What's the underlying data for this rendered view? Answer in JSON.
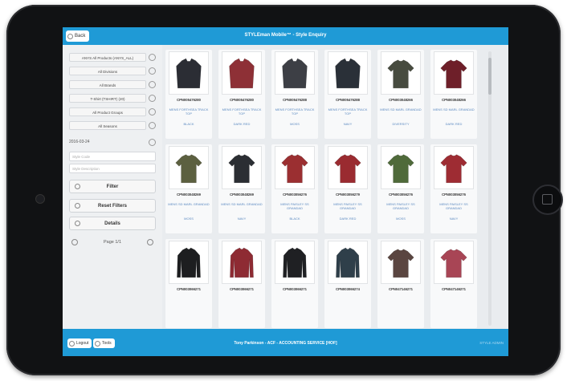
{
  "header": {
    "back_label": "Back",
    "title": "STYLEman Mobile™ - Style Enquiry"
  },
  "filters": {
    "product_scope": "ANYS All Products (ANYS_ALL)",
    "division": "All Divisions",
    "brand": "All Brands",
    "product_type": "T-Shirt (TSHIRT) (20)",
    "product_group": "All Product Groups",
    "season": "All Seasons",
    "date": "2016-03-24",
    "style_code_placeholder": "Style Code",
    "description_placeholder": "Style Description",
    "filter_label": "Filter",
    "reset_label": "Reset Filters",
    "details_label": "Details",
    "page_label": "Page 1/1"
  },
  "products": [
    {
      "code": "CPN005476280",
      "desc": "MENS FORTHSEA TRACK TOP",
      "color": "BLACK",
      "hex": "#2b2d34",
      "shape": "jacket"
    },
    {
      "code": "CPN005476280",
      "desc": "MENS FORTHSEA TRACK TOP",
      "color": "DARK RED",
      "hex": "#8e3036",
      "shape": "jacket"
    },
    {
      "code": "CPN005476288",
      "desc": "MENS FORTHSEA TRACK TOP",
      "color": "MOSS",
      "hex": "#3d3f45",
      "shape": "jacket"
    },
    {
      "code": "CPN005476288",
      "desc": "MENS FORTHSEA TRACK TOP",
      "color": "NAVY",
      "hex": "#2a3038",
      "shape": "jacket"
    },
    {
      "code": "CPN003048266",
      "desc": "MENS SD MARL GRANDAD",
      "color": "DIVERSITY",
      "hex": "#474b3f",
      "shape": "tee"
    },
    {
      "code": "CPN003048266",
      "desc": "MENS SD MARL GRANDAD",
      "color": "DARK RED",
      "hex": "#6e1f29",
      "shape": "tee"
    },
    {
      "code": "CPN003048269",
      "desc": "MENS SD MARL GRANDAD",
      "color": "MOSS",
      "hex": "#5c6040",
      "shape": "tee"
    },
    {
      "code": "CPN003048269",
      "desc": "MENS SD MARL GRANDAD",
      "color": "NAVY",
      "hex": "#2b2e33",
      "shape": "tee"
    },
    {
      "code": "CPN003056276",
      "desc": "MENS PAISLEY SS GRANDAD",
      "color": "BLACK",
      "hex": "#9b2f31",
      "shape": "tee"
    },
    {
      "code": "CPN003056279",
      "desc": "MENS PAISLEY SS GRANDAD",
      "color": "DARK RED",
      "hex": "#9a2b30",
      "shape": "tee"
    },
    {
      "code": "CPN003056276",
      "desc": "MENS PAISLEY SS GRANDAD",
      "color": "MOSS",
      "hex": "#4f6a3a",
      "shape": "tee"
    },
    {
      "code": "CPN003056276",
      "desc": "MENS PAISLEY SS GRANDAD",
      "color": "NAVY",
      "hex": "#9e2c33",
      "shape": "tee"
    },
    {
      "code": "CPN003066271",
      "desc": "",
      "color": "",
      "hex": "#1d1e20",
      "shape": "long"
    },
    {
      "code": "CPN003066271",
      "desc": "",
      "color": "",
      "hex": "#8e2b33",
      "shape": "long"
    },
    {
      "code": "CPN003066271",
      "desc": "",
      "color": "",
      "hex": "#1f2023",
      "shape": "long"
    },
    {
      "code": "CPN003066274",
      "desc": "",
      "color": "",
      "hex": "#2f3f4a",
      "shape": "long"
    },
    {
      "code": "CPN047146271",
      "desc": "",
      "color": "",
      "hex": "#5a4540",
      "shape": "tee"
    },
    {
      "code": "CPN047146271",
      "desc": "",
      "color": "",
      "hex": "#a84555",
      "shape": "tee"
    }
  ],
  "footer": {
    "logout_label": "Logout",
    "tools_label": "Tools",
    "user_info": "Tony Parkinson - ACF - ACCOUNTING SERVICE [HOF]",
    "right_text": "STYLE ADMIN"
  }
}
